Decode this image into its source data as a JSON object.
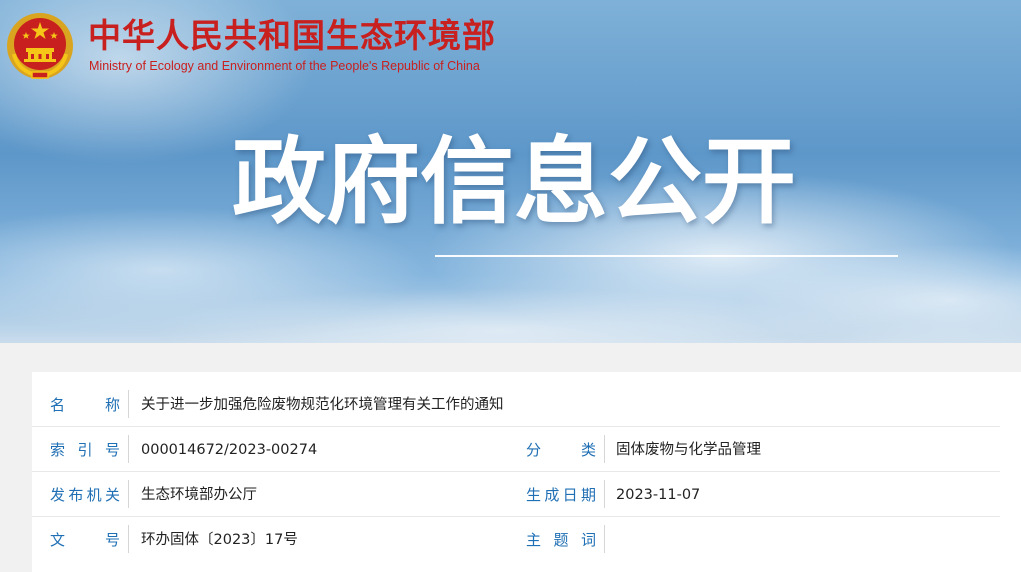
{
  "header": {
    "site_name_cn": "中华人民共和国生态环境部",
    "site_name_en": "Ministry of Ecology and Environment of the People's Republic of China",
    "emblem_icon": "national-emblem-icon",
    "banner_title": "政府信息公开",
    "brand_color": "#c8201e"
  },
  "document_info": {
    "label_color": "#1f6fb4",
    "rows": [
      {
        "label": "名　称",
        "value": "关于进一步加强危险废物规范化环境管理有关工作的通知"
      },
      {
        "label": "索引号",
        "value": "000014672/2023-00274",
        "label2": "分　类",
        "value2": "固体废物与化学品管理"
      },
      {
        "label": "发布机关",
        "value": "生态环境部办公厅",
        "label2": "生成日期",
        "value2": "2023-11-07"
      },
      {
        "label": "文　号",
        "value": "环办固体〔2023〕17号",
        "label2": "主题词",
        "value2": ""
      }
    ]
  }
}
